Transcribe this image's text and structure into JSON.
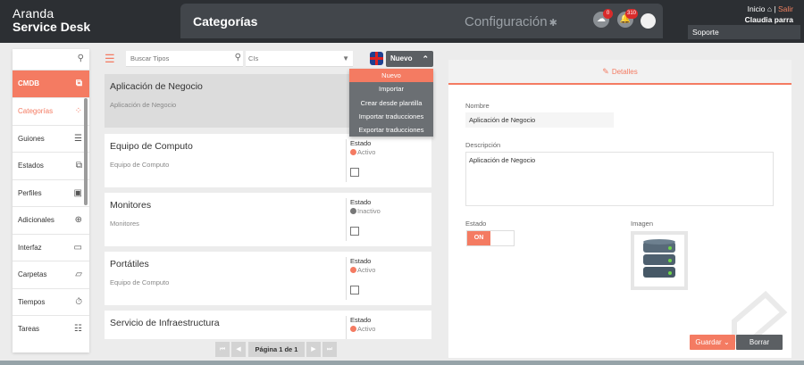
{
  "header": {
    "logo_line1": "Aranda",
    "logo_line2": "Service Desk",
    "page_title": "Categorías",
    "section": "Configuración",
    "badges": {
      "cloud": "0",
      "bell": "310"
    },
    "inicio": "Inicio",
    "separator": "|",
    "salir": "Salir",
    "user": "Claudia parra",
    "project": "Soporte"
  },
  "sidebar": {
    "items": [
      {
        "label": "CMDB",
        "icon": "cmdb-icon"
      },
      {
        "label": "Categorías",
        "icon": "grid-icon"
      },
      {
        "label": "Guiones",
        "icon": "list-icon"
      },
      {
        "label": "Estados",
        "icon": "copy-icon"
      },
      {
        "label": "Perfiles",
        "icon": "id-card-icon"
      },
      {
        "label": "Adicionales",
        "icon": "plus-circle-icon"
      },
      {
        "label": "Interfaz",
        "icon": "monitor-icon"
      },
      {
        "label": "Carpetas",
        "icon": "folder-icon"
      },
      {
        "label": "Tiempos",
        "icon": "stopwatch-icon"
      },
      {
        "label": "Tareas",
        "icon": "tasks-icon"
      }
    ]
  },
  "toolbar": {
    "search_placeholder": "Buscar Tipos",
    "cis_select": "CIs",
    "nuevo_label": "Nuevo"
  },
  "dropdown": {
    "items": [
      "Nuevo",
      "Importar",
      "Crear desde plantilla",
      "Importar traducciones",
      "Exportar traducciones"
    ]
  },
  "list": {
    "state_label": "Estado",
    "rows": [
      {
        "title": "Aplicación de Negocio",
        "subtitle": "Aplicación de Negocio",
        "state": ""
      },
      {
        "title": "Equipo de Computo",
        "subtitle": "Equipo de Computo",
        "state": "Activo"
      },
      {
        "title": "Monitores",
        "subtitle": "Monitores",
        "state": "Inactivo"
      },
      {
        "title": "Portátiles",
        "subtitle": "Equipo de Computo",
        "state": "Activo"
      },
      {
        "title": "Servicio de Infraestructura",
        "subtitle": "",
        "state": "Activo"
      }
    ]
  },
  "pagination": {
    "first": "⏮",
    "prev": "◀",
    "text": "Página 1 de 1",
    "next": "▶",
    "last": "⏭"
  },
  "detail": {
    "tab_label": "Detalles",
    "name_label": "Nombre",
    "name_value": "Aplicación de Negocio",
    "desc_label": "Descripción",
    "desc_value": "Aplicación de Negocio",
    "state_label": "Estado",
    "toggle_on": "ON",
    "image_label": "Imagen",
    "save_label": "Guardar",
    "delete_label": "Borrar"
  },
  "colors": {
    "accent": "#f47b62",
    "active": "#f47b62",
    "inactive": "#777777"
  }
}
